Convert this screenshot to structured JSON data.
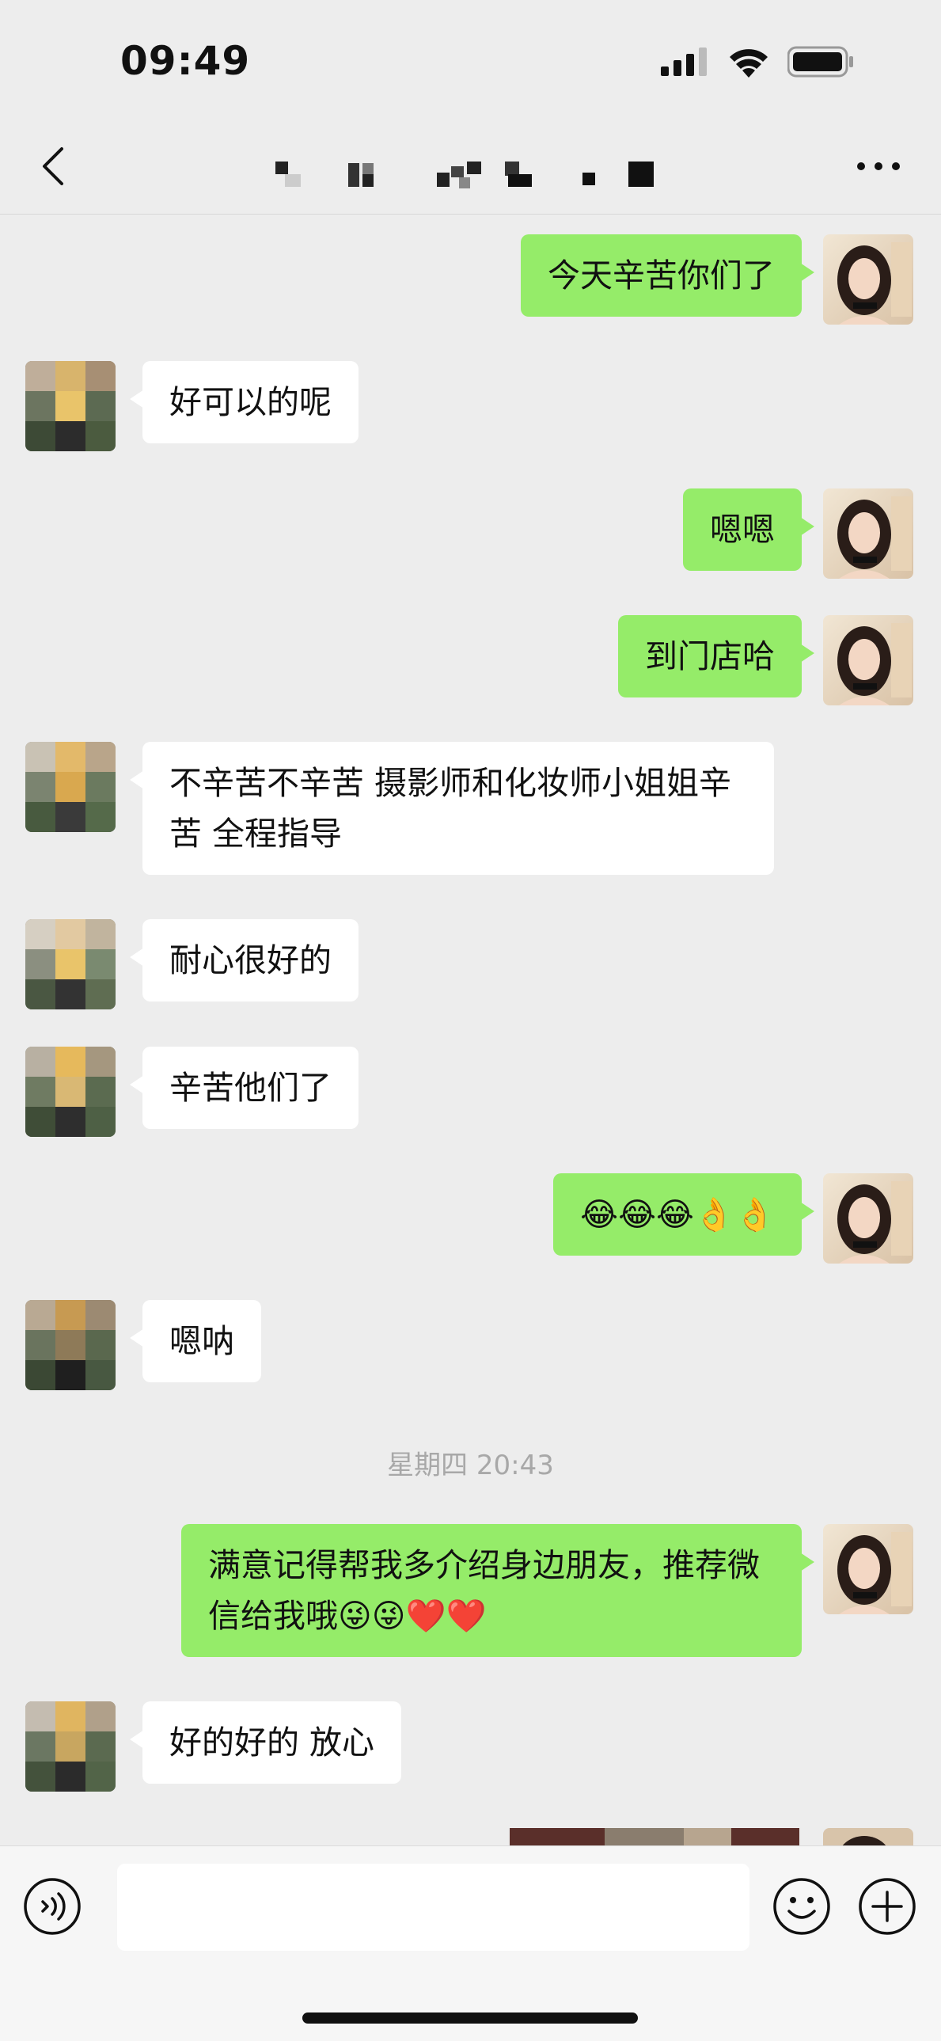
{
  "status_bar": {
    "time": "09:49"
  },
  "nav": {
    "title": ""
  },
  "messages": [
    {
      "side": "self",
      "text": "今天辛苦你们了"
    },
    {
      "side": "peer",
      "text": "好可以的呢"
    },
    {
      "side": "self",
      "text": "嗯嗯"
    },
    {
      "side": "self",
      "text": "到门店哈"
    },
    {
      "side": "peer",
      "text": "不辛苦不辛苦 摄影师和化妆师小姐姐辛苦 全程指导"
    },
    {
      "side": "peer",
      "text": "耐心很好的"
    },
    {
      "side": "peer",
      "text": "辛苦他们了"
    },
    {
      "side": "self",
      "text": "😂😂😂👌👌"
    },
    {
      "side": "peer",
      "text": "嗯呐"
    },
    {
      "side": "self",
      "text": "满意记得帮我多介绍身边朋友，推荐微信给我哦😜😜❤️❤️"
    },
    {
      "side": "peer",
      "text": "好的好的 放心"
    }
  ],
  "timestamp": "星期四 20:43",
  "colors": {
    "self_bubble": "#95ec69",
    "peer_bubble": "#ffffff",
    "background": "#ededed"
  },
  "icons": [
    "back-icon",
    "more-icon",
    "signal-icon",
    "wifi-icon",
    "battery-icon",
    "voice-icon",
    "emoji-icon",
    "plus-icon"
  ]
}
